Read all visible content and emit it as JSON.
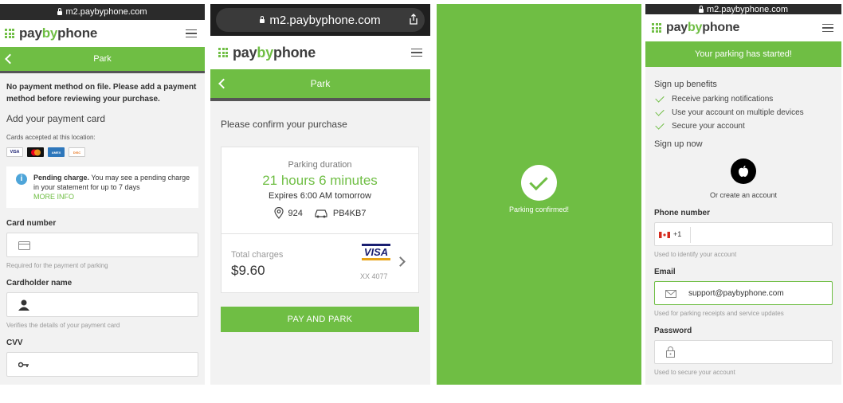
{
  "url": "m2.paybyphone.com",
  "brand": {
    "pay": "pay",
    "by": "by",
    "phone": "phone"
  },
  "colors": {
    "accent": "#6fbe44",
    "info": "#4ea5d9",
    "dark": "#2b2b2b"
  },
  "screen1": {
    "header_title": "Park",
    "warning": "No payment method on file. Please add a payment method before reviewing your purchase.",
    "add_card_heading": "Add your payment card",
    "cards_accepted": "Cards accepted at this location:",
    "card_brands": [
      "VISA",
      "mastercard",
      "AMERICAN EXPRESS",
      "DISCOVER"
    ],
    "notice_bold": "Pending charge.",
    "notice_text": " You may see a pending charge in your statement for up to 7 days",
    "notice_link": "MORE INFO",
    "card_number_label": "Card number",
    "card_number_hint": "Required for the payment of parking",
    "cardholder_label": "Cardholder name",
    "cardholder_hint": "Verifies the details of your payment card",
    "cvv_label": "CVV"
  },
  "screen2": {
    "header_title": "Park",
    "confirm_heading": "Please confirm your purchase",
    "duration_label": "Parking duration",
    "duration_value": "21 hours 6 minutes",
    "expires": "Expires 6:00 AM tomorrow",
    "location": "924",
    "plate": "PB4KB7",
    "total_label": "Total charges",
    "total_value": "$9.60",
    "card_brand": "VISA",
    "card_last": "XX 4077",
    "pay_button": "PAY AND PARK"
  },
  "screen3": {
    "confirmed": "Parking confirmed!"
  },
  "screen4": {
    "banner": "Your parking has started!",
    "benefits_heading": "Sign up benefits",
    "benefits": [
      "Receive parking notifications",
      "Use your account on multiple devices",
      "Secure your account"
    ],
    "signup_now": "Sign up now",
    "or_create": "Or create an account",
    "phone_label": "Phone number",
    "phone_code": "+1",
    "phone_hint": "Used to identify your account",
    "email_label": "Email",
    "email_value": "support@paybyphone.com",
    "email_hint": "Used for parking receipts and service updates",
    "password_label": "Password",
    "password_hint": "Used to secure your account"
  }
}
